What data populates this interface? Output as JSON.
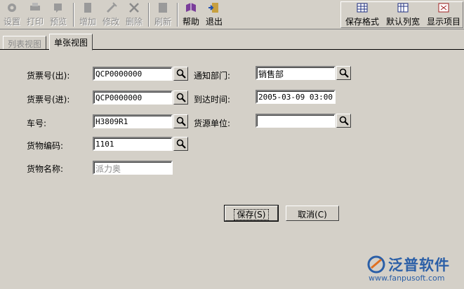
{
  "toolbar": {
    "left_buttons": [
      {
        "label": "设置",
        "icon": "gear-icon",
        "enabled": false
      },
      {
        "label": "打印",
        "icon": "print-icon",
        "enabled": false
      },
      {
        "label": "预览",
        "icon": "preview-icon",
        "enabled": false
      },
      {
        "label": "增加",
        "icon": "add-doc-icon",
        "enabled": false
      },
      {
        "label": "修改",
        "icon": "edit-icon",
        "enabled": false
      },
      {
        "label": "删除",
        "icon": "delete-icon",
        "enabled": false
      },
      {
        "label": "刷新",
        "icon": "refresh-icon",
        "enabled": false
      },
      {
        "label": "帮助",
        "icon": "book-icon",
        "enabled": true
      },
      {
        "label": "退出",
        "icon": "exit-door-icon",
        "enabled": true
      }
    ],
    "right_buttons": [
      {
        "label": "保存格式",
        "icon": "grid-icon"
      },
      {
        "label": "默认列宽",
        "icon": "columns-icon"
      },
      {
        "label": "显示项目",
        "icon": "display-items-icon"
      }
    ]
  },
  "tabs": {
    "list_view": "列表视图",
    "single_view": "单张视图",
    "active": "single_view"
  },
  "form": {
    "fields": {
      "invoice_out": {
        "label": "货票号(出):",
        "value": "QCP0000000"
      },
      "invoice_in": {
        "label": "货票号(进):",
        "value": "QCP0000000"
      },
      "vehicle_no": {
        "label": "车号:",
        "value": "H3809R1"
      },
      "goods_code": {
        "label": "货物编码:",
        "value": "1101"
      },
      "goods_name": {
        "label": "货物名称:",
        "value": "派力奥"
      },
      "notify_dept": {
        "label": "通知部门:",
        "value": "销售部"
      },
      "arrival_time": {
        "label": "到达时间:",
        "value": "2005-03-09 03:00"
      },
      "source_unit": {
        "label": "货源单位:",
        "value": ""
      }
    },
    "save_label": "保存(S)",
    "cancel_label": "取消(C)"
  },
  "watermark": {
    "brand": "泛普软件",
    "url": "www.fanpusoft.com"
  },
  "colors": {
    "face": "#d4d0c8",
    "brand_blue": "#2b5fa7",
    "disabled_text": "#8a8a8a"
  }
}
